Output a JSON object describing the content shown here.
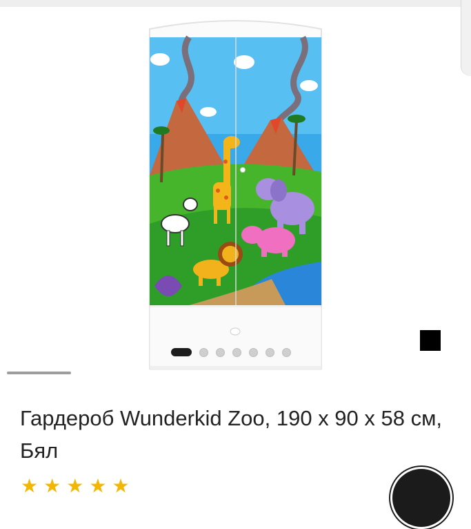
{
  "product": {
    "title": "Гардероб Wunderkid Zoo, 190 x 90 x 58 см, Бял",
    "image_icon": "wardrobe-zoo-product-image",
    "rating_icon": "star-icon",
    "rating_stars": [
      "★",
      "★",
      "★",
      "★",
      "★"
    ]
  },
  "gallery": {
    "slide_count": 7,
    "active_slide": 1,
    "fullscreen_icon": "black-square-icon"
  },
  "colors": {
    "text": "#222222",
    "star": "#f2b705",
    "indicator_active": "#1c1c1c",
    "indicator_inactive": "#cfcfcf"
  }
}
